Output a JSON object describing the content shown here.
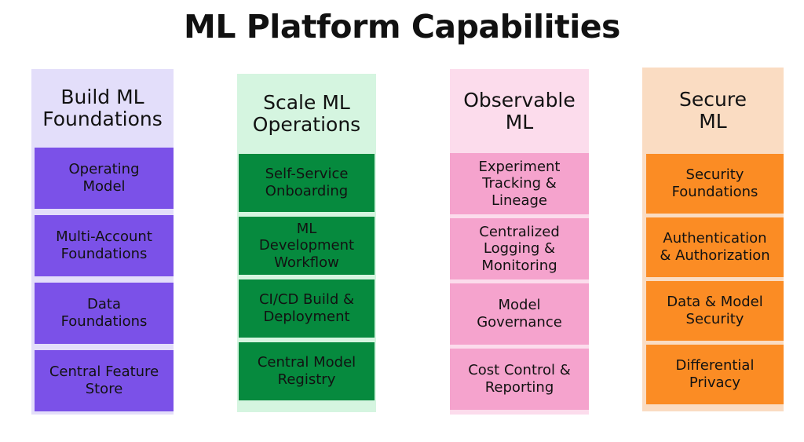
{
  "title": "ML Platform Capabilities",
  "columns": [
    {
      "id": "build-ml-foundations",
      "header": "Build ML\nFoundations",
      "header_bg": "#e3defa",
      "item_bg": "#7b51e8",
      "text_color": "#121212",
      "items": [
        "Operating\nModel",
        "Multi-Account\nFoundations",
        "Data\nFoundations",
        "Central Feature\nStore"
      ]
    },
    {
      "id": "scale-ml-operations",
      "header": "Scale ML\nOperations",
      "header_bg": "#d5f5e0",
      "item_bg": "#068a3e",
      "text_color": "#121212",
      "items": [
        "Self-Service\nOnboarding",
        "ML\nDevelopment\nWorkflow",
        "CI/CD Build &\nDeployment",
        "Central Model\nRegistry"
      ]
    },
    {
      "id": "observable-ml",
      "header": "Observable\nML",
      "header_bg": "#fcdcec",
      "item_bg": "#f5a3cd",
      "text_color": "#121212",
      "items": [
        "Experiment\nTracking &\nLineage",
        "Centralized\nLogging &\nMonitoring",
        "Model\nGovernance",
        "Cost Control &\nReporting"
      ]
    },
    {
      "id": "secure-ml",
      "header": "Secure\nML",
      "header_bg": "#fadcc2",
      "item_bg": "#fb8c24",
      "text_color": "#121212",
      "items": [
        "Security\nFoundations",
        "Authentication\n& Authorization",
        "Data & Model\nSecurity",
        "Differential\nPrivacy"
      ]
    }
  ]
}
